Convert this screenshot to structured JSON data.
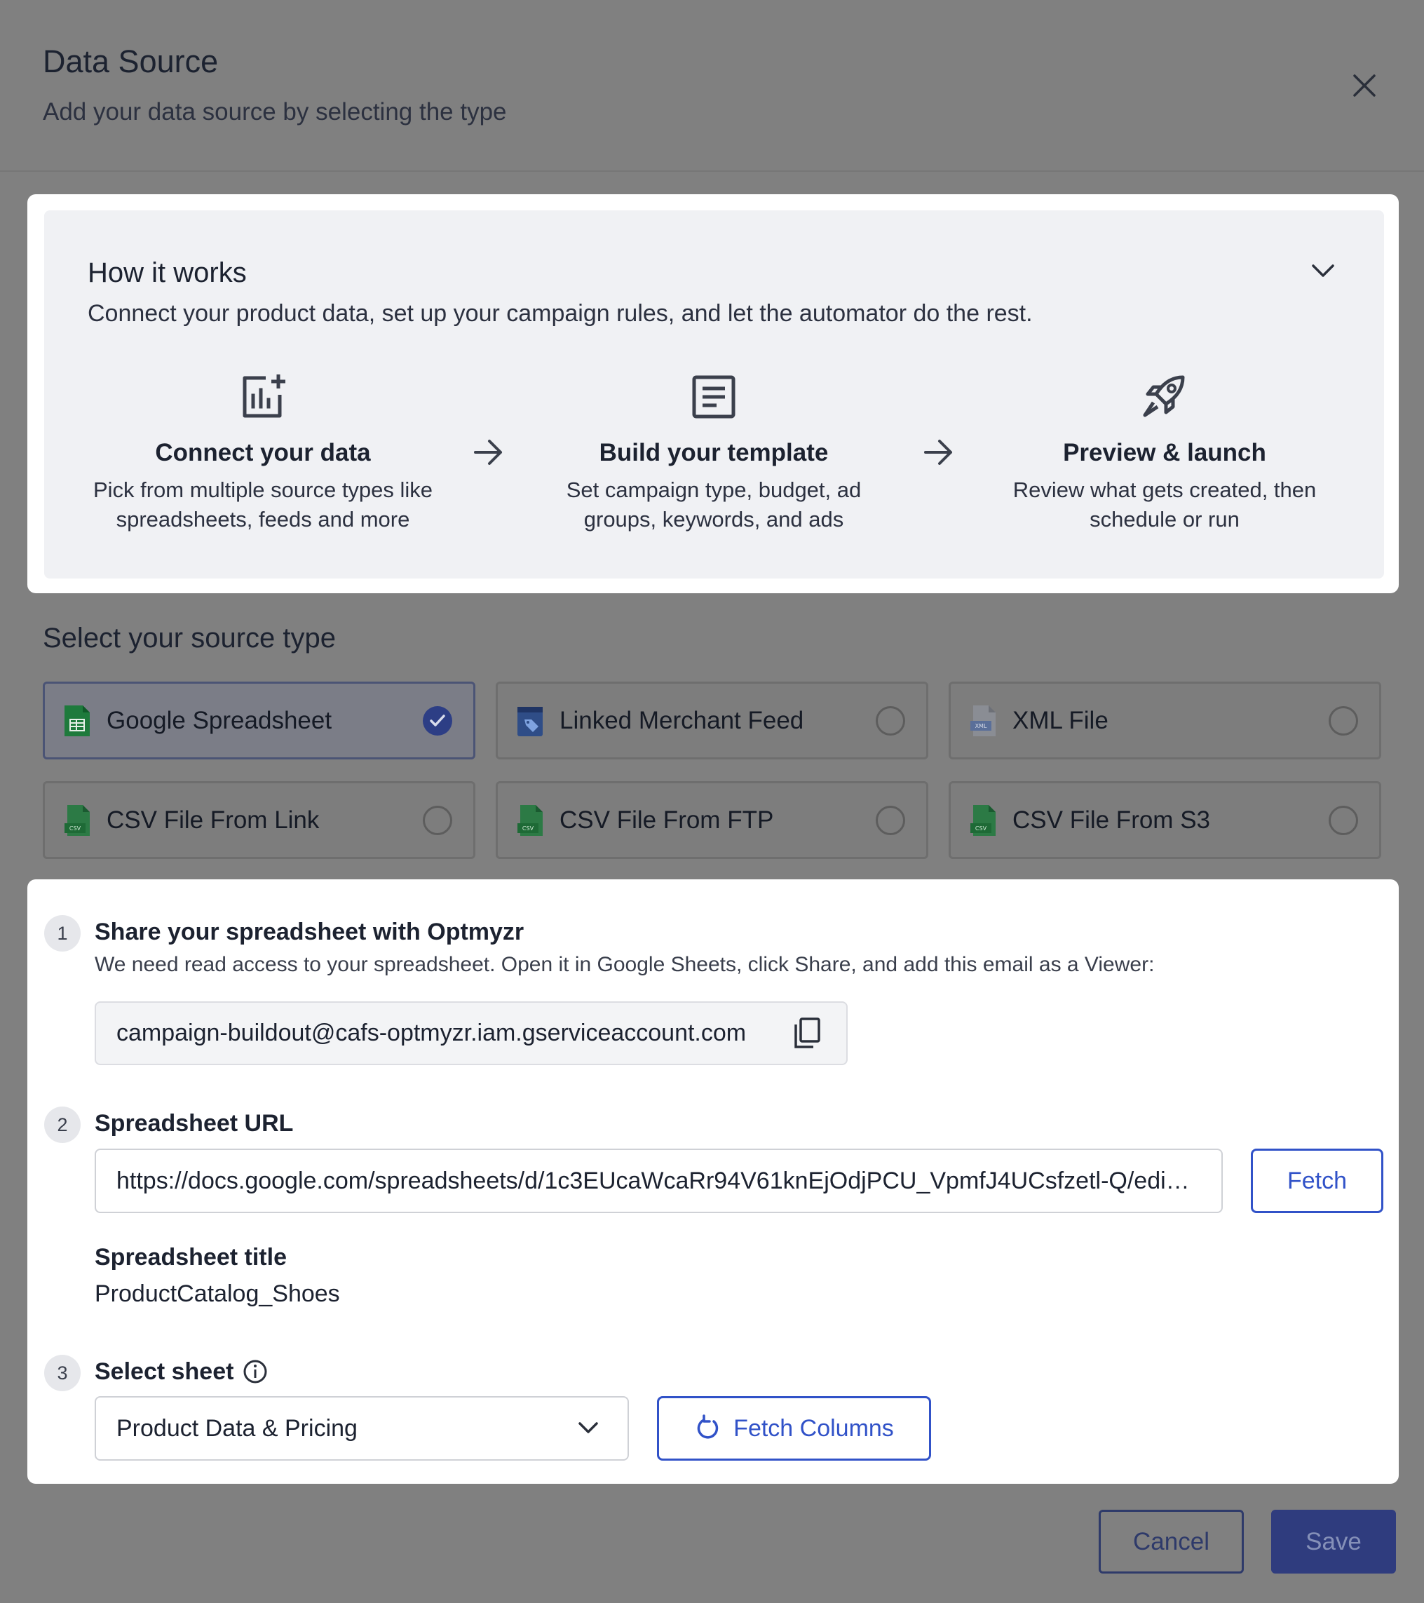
{
  "header": {
    "title": "Data Source",
    "subtitle": "Add your data source by selecting the type"
  },
  "how_it_works": {
    "title": "How it works",
    "description": "Connect your product data, set up your campaign rules, and let the automator do the rest.",
    "steps": [
      {
        "title": "Connect your data",
        "desc_line1": "Pick from multiple source types like",
        "desc_line2": "spreadsheets, feeds and more",
        "icon": "chart-add-icon"
      },
      {
        "title": "Build your template",
        "desc_line1": "Set campaign type, budget, ad",
        "desc_line2": "groups, keywords, and ads",
        "icon": "document-icon"
      },
      {
        "title": "Preview & launch",
        "desc_line1": "Review what gets created, then",
        "desc_line2": "schedule or run",
        "icon": "rocket-icon"
      }
    ]
  },
  "source_type": {
    "title": "Select your source type",
    "options": [
      {
        "label": "Google Spreadsheet",
        "selected": true,
        "icon": "google-sheets-icon"
      },
      {
        "label": "Linked Merchant Feed",
        "selected": false,
        "icon": "merchant-feed-icon"
      },
      {
        "label": "XML File",
        "selected": false,
        "icon": "xml-file-icon"
      },
      {
        "label": "CSV File From Link",
        "selected": false,
        "icon": "csv-file-icon"
      },
      {
        "label": "CSV File From FTP",
        "selected": false,
        "icon": "csv-file-icon"
      },
      {
        "label": "CSV File From S3",
        "selected": false,
        "icon": "csv-file-icon"
      }
    ]
  },
  "step1": {
    "number": "1",
    "title": "Share your spreadsheet with Optmyzr",
    "description": "We need read access to your spreadsheet. Open it in Google Sheets, click Share, and add this email as a Viewer:",
    "email": "campaign-buildout@cafs-optmyzr.iam.gserviceaccount.com"
  },
  "step2": {
    "number": "2",
    "title": "Spreadsheet URL",
    "url_value": "https://docs.google.com/spreadsheets/d/1c3EUcaWcaRr94V61knEjOdjPCU_VpmfJ4UCsfzetl-Q/edi…",
    "fetch_label": "Fetch",
    "sheet_title_label": "Spreadsheet title",
    "sheet_title_value": "ProductCatalog_Shoes"
  },
  "step3": {
    "number": "3",
    "title": "Select sheet",
    "selected_sheet": "Product Data & Pricing",
    "fetch_columns_label": "Fetch Columns"
  },
  "footer": {
    "cancel_label": "Cancel",
    "save_label": "Save"
  },
  "colors": {
    "accent": "#3152c8",
    "primary_dark": "#2f3c7e",
    "overlay": "#808080"
  }
}
